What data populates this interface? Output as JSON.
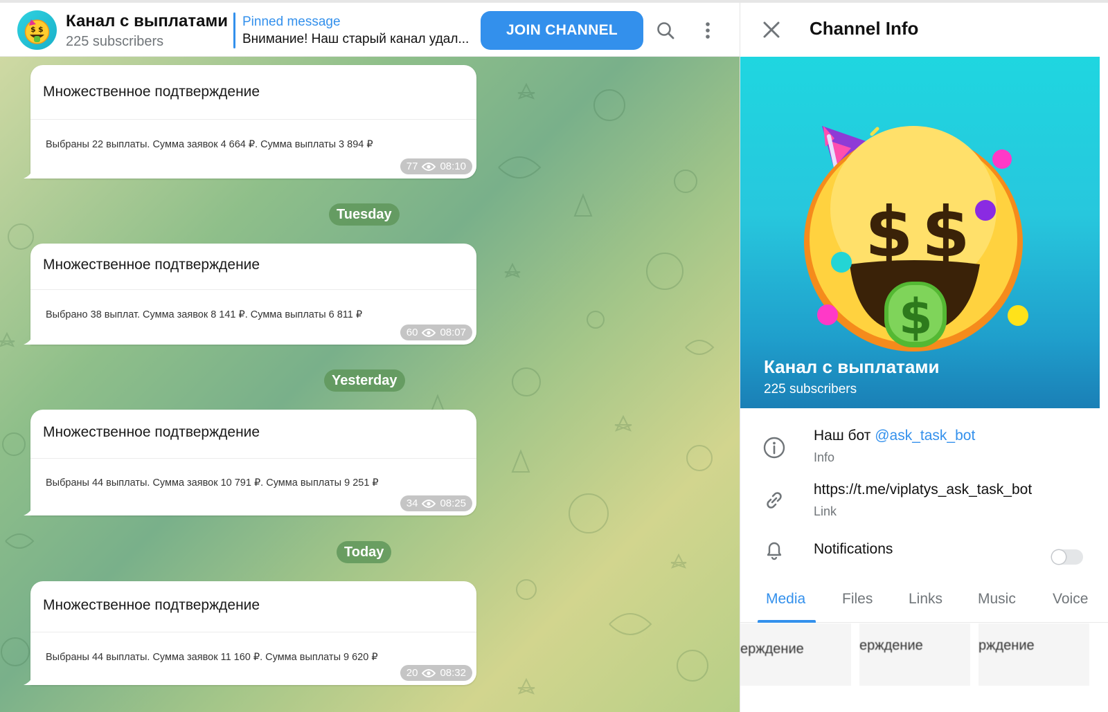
{
  "chat": {
    "title": "Канал с выплатами",
    "subscribers": "225 subscribers",
    "pinned_label": "Pinned message",
    "pinned_text": "Внимание! Наш старый канал удал...",
    "join_label": "JOIN CHANNEL",
    "messages": [
      {
        "title": "Множественное подтверждение",
        "body": "Выбраны 22 выплаты. Сумма заявок 4 664 ₽. Сумма выплаты 3 894 ₽",
        "views": "77",
        "time": "08:10"
      },
      {
        "title": "Множественное подтверждение",
        "body": "Выбрано 38 выплат. Сумма заявок 8 141 ₽. Сумма выплаты 6 811 ₽",
        "views": "60",
        "time": "08:07"
      },
      {
        "title": "Множественное подтверждение",
        "body": "Выбраны 44 выплаты. Сумма заявок 10 791 ₽. Сумма выплаты 9 251 ₽",
        "views": "34",
        "time": "08:25"
      },
      {
        "title": "Множественное подтверждение",
        "body": "Выбраны 44 выплаты. Сумма заявок 11 160 ₽. Сумма выплаты 9 620 ₽",
        "views": "20",
        "time": "08:32"
      }
    ],
    "date_separators": [
      "Tuesday",
      "Yesterday",
      "Today"
    ]
  },
  "info": {
    "title": "Channel Info",
    "name": "Канал с выплатами",
    "subscribers": "225 subscribers",
    "description_prefix": "Наш бот ",
    "description_mention": "@ask_task_bot",
    "description_label": "Info",
    "link": "https://t.me/viplatys_ask_task_bot",
    "link_label": "Link",
    "notifications_label": "Notifications",
    "notifications_on": false,
    "tabs": [
      "Media",
      "Files",
      "Links",
      "Music",
      "Voice"
    ],
    "active_tab": "Media",
    "thumbs": [
      "ерждение",
      "ерждение",
      "рждение"
    ]
  },
  "icons": {
    "avatar": "money-mouth-face-icon",
    "search": "search-icon",
    "more": "more-vertical-icon",
    "close": "close-icon",
    "info": "info-icon",
    "link": "link-icon",
    "bell": "bell-icon",
    "views": "eye-icon"
  },
  "colors": {
    "accent": "#3390ec",
    "date_pill": "#5f965a",
    "hero_top": "#1fd6e0"
  }
}
